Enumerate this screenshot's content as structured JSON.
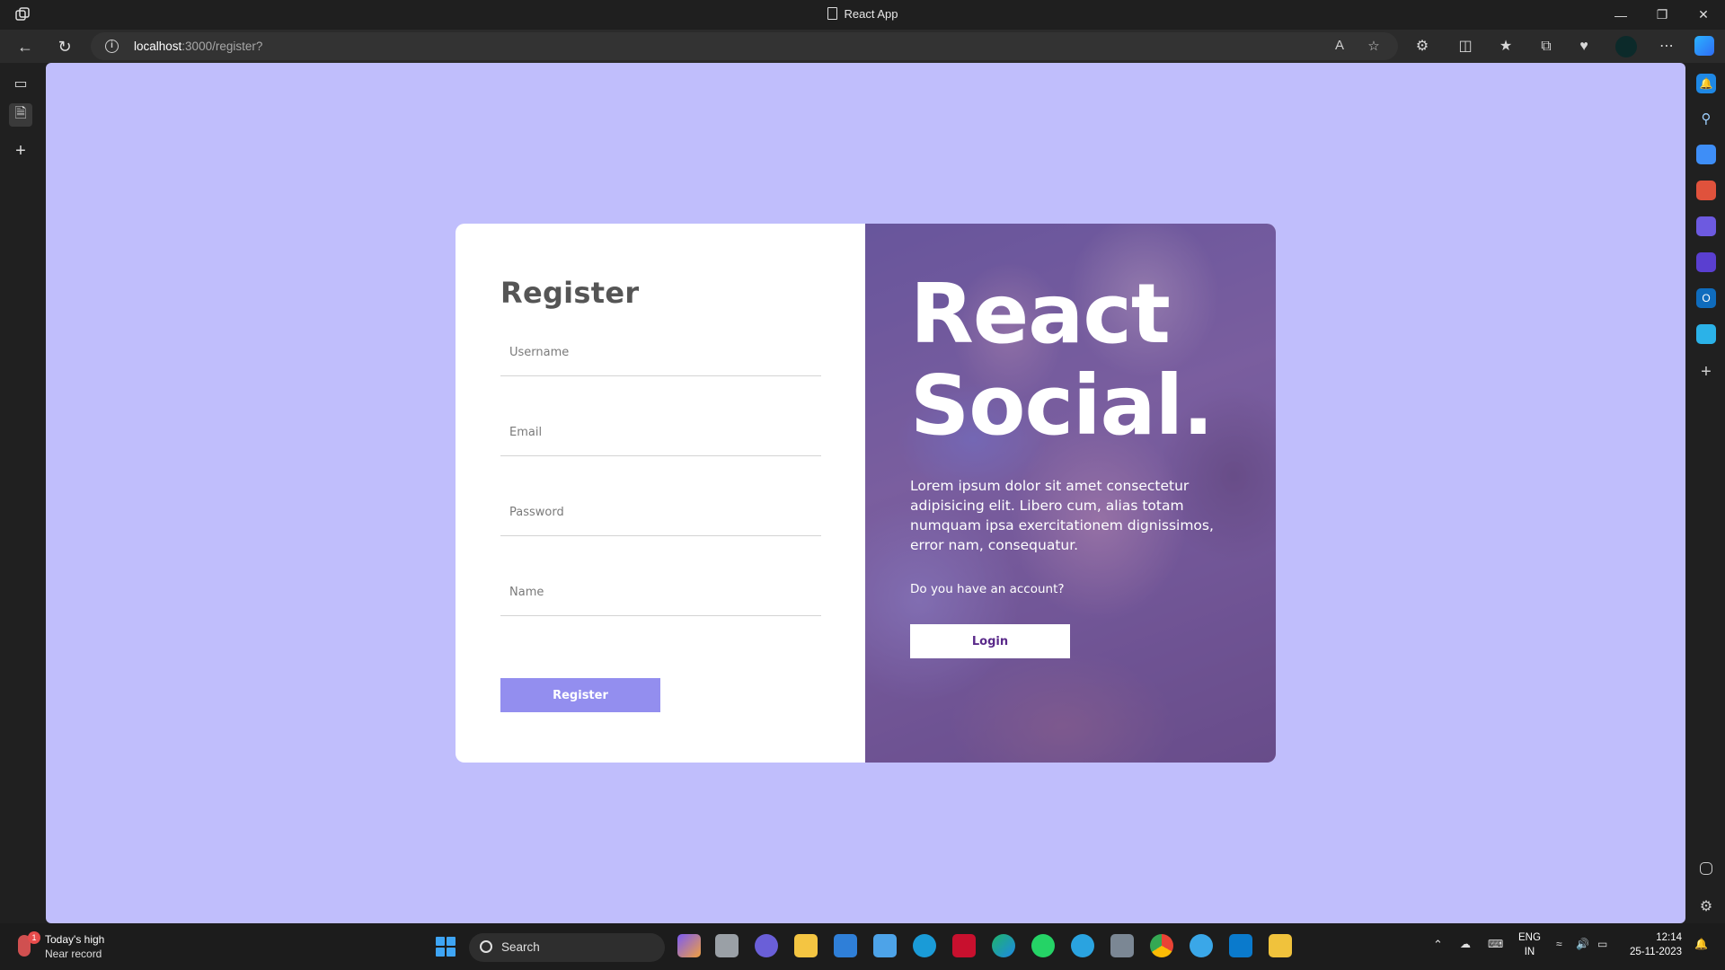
{
  "browser": {
    "tab_title": "React App",
    "url_host": "localhost",
    "url_path": ":3000/register?"
  },
  "page": {
    "register_title": "Register",
    "fields": {
      "username_placeholder": "Username",
      "email_placeholder": "Email",
      "password_placeholder": "Password",
      "name_placeholder": "Name"
    },
    "register_button": "Register",
    "brand_line1": "React",
    "brand_line2": "Social.",
    "description": "Lorem ipsum dolor sit amet consectetur adipisicing elit. Libero cum, alias totam numquam ipsa exercitationem dignissimos, error nam, consequatur.",
    "question": "Do you have an account?",
    "login_button": "Login"
  },
  "taskbar": {
    "weather_line1": "Today's high",
    "weather_line2": "Near record",
    "weather_badge": "1",
    "search_label": "Search",
    "lang_line1": "ENG",
    "lang_line2": "IN",
    "time": "12:14",
    "date": "25-11-2023"
  },
  "colors": {
    "page_bg": "#c0befc",
    "register_button": "#938eef",
    "login_text": "#5a2a8a",
    "heading": "#555555"
  }
}
